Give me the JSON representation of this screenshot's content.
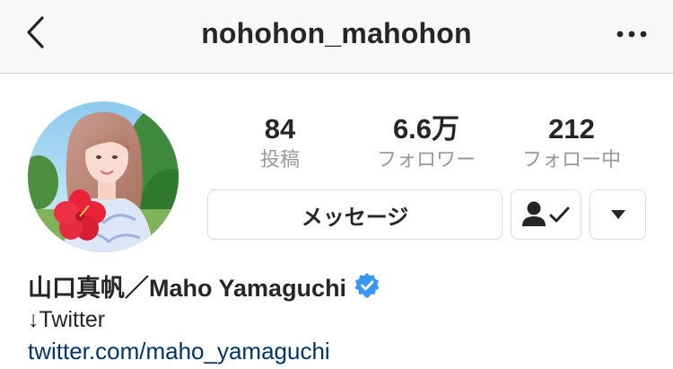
{
  "nav": {
    "title": "nohohon_mahohon",
    "back_icon": "chevron-left-icon",
    "more_icon": "ellipsis-horizontal-icon"
  },
  "profile": {
    "avatar_icon": "profile-photo",
    "stats": [
      {
        "value": "84",
        "label": "投稿"
      },
      {
        "value": "6.6万",
        "label": "フォロワー"
      },
      {
        "value": "212",
        "label": "フォロー中"
      }
    ],
    "buttons": {
      "message_label": "メッセージ",
      "following_icon": "person-check-icon",
      "dropdown_icon": "caret-down-icon"
    },
    "display_name": "山口真帆／Maho Yamaguchi",
    "verified_icon": "verified-badge-icon",
    "bio_line": "↓Twitter",
    "link": "twitter.com/maho_yamaguchi"
  },
  "colors": {
    "text": "#262626",
    "secondary_text": "#999999",
    "link": "#003569",
    "verified": "#3897f0",
    "nav_background": "#f8f8f9",
    "border": "#dbdbdb"
  }
}
